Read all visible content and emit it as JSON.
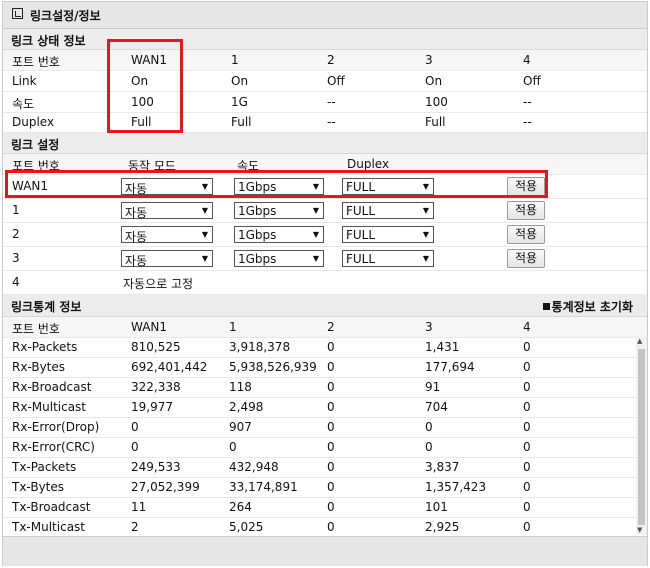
{
  "title": "링크설정/정보",
  "status": {
    "section_title": "링크 상태 정보",
    "columns": [
      "포트 번호",
      "WAN1",
      "1",
      "2",
      "3",
      "4"
    ],
    "rows": [
      [
        "Link",
        "On",
        "On",
        "Off",
        "On",
        "Off"
      ],
      [
        "속도",
        "100",
        "1G",
        "--",
        "100",
        "--"
      ],
      [
        "Duplex",
        "Full",
        "Full",
        "--",
        "Full",
        "--"
      ]
    ]
  },
  "settings": {
    "section_title": "링크 설정",
    "columns": [
      "포트 번호",
      "동작 모드",
      "속도",
      "Duplex"
    ],
    "rows": [
      {
        "port": "WAN1",
        "mode": "자동",
        "speed": "1Gbps",
        "duplex": "FULL",
        "apply": "적용"
      },
      {
        "port": "1",
        "mode": "자동",
        "speed": "1Gbps",
        "duplex": "FULL",
        "apply": "적용"
      },
      {
        "port": "2",
        "mode": "자동",
        "speed": "1Gbps",
        "duplex": "FULL",
        "apply": "적용"
      },
      {
        "port": "3",
        "mode": "자동",
        "speed": "1Gbps",
        "duplex": "FULL",
        "apply": "적용"
      }
    ],
    "fixed_row": {
      "port": "4",
      "text": "자동으로 고정"
    }
  },
  "stats": {
    "section_title": "링크통계 정보",
    "reset_label": "통계정보 초기화",
    "columns": [
      "포트 번호",
      "WAN1",
      "1",
      "2",
      "3",
      "4"
    ],
    "rows": [
      [
        "Rx-Packets",
        "810,525",
        "3,918,378",
        "0",
        "1,431",
        "0"
      ],
      [
        "Rx-Bytes",
        "692,401,442",
        "5,938,526,939",
        "0",
        "177,694",
        "0"
      ],
      [
        "Rx-Broadcast",
        "322,338",
        "118",
        "0",
        "91",
        "0"
      ],
      [
        "Rx-Multicast",
        "19,977",
        "2,498",
        "0",
        "704",
        "0"
      ],
      [
        "Rx-Error(Drop)",
        "0",
        "907",
        "0",
        "0",
        "0"
      ],
      [
        "Rx-Error(CRC)",
        "0",
        "0",
        "0",
        "0",
        "0"
      ],
      [
        "Tx-Packets",
        "249,533",
        "432,948",
        "0",
        "3,837",
        "0"
      ],
      [
        "Tx-Bytes",
        "27,052,399",
        "33,174,891",
        "0",
        "1,357,423",
        "0"
      ],
      [
        "Tx-Broadcast",
        "11",
        "264",
        "0",
        "101",
        "0"
      ],
      [
        "Tx-Multicast",
        "2",
        "5,025",
        "0",
        "2,925",
        "0"
      ]
    ]
  },
  "colors": {
    "highlight": "#e01a1a",
    "section_bg": "#ececec",
    "title_bg": "#e6e6e6"
  }
}
